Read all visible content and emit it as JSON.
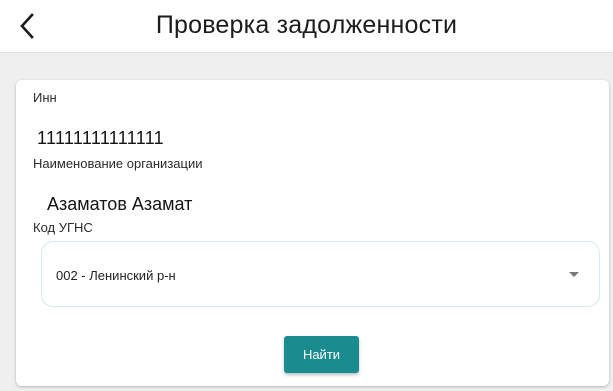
{
  "header": {
    "title": "Проверка задолженности",
    "back_icon": "chevron-left-icon"
  },
  "form": {
    "inn": {
      "label": "Инн",
      "value": "11111111111111"
    },
    "organization": {
      "label": "Наименование организации",
      "value": "Азаматов Азамат"
    },
    "ugns": {
      "label": "Код УГНС",
      "selected": "002 - Ленинский р-н",
      "arrow_icon": "caret-down-icon"
    },
    "submit_label": "Найти"
  },
  "colors": {
    "accent": "#1a8c90",
    "background": "#efefef",
    "card": "#ffffff"
  }
}
